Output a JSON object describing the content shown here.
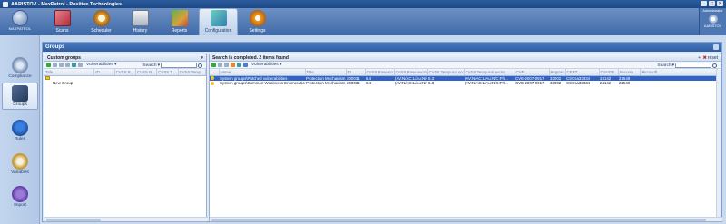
{
  "window": {
    "title": "AARISTOV - MaxPatrol - Positive Technologies",
    "controls": [
      "_",
      "□",
      "✕"
    ]
  },
  "logo": {
    "text": "MAXPATROL"
  },
  "ribbon": {
    "tabs": [
      {
        "label": "Scans",
        "icon": "scans-icon"
      },
      {
        "label": "Scheduler",
        "icon": "scheduler-icon"
      },
      {
        "label": "History",
        "icon": "history-icon"
      },
      {
        "label": "Reports",
        "icon": "reports-icon"
      },
      {
        "label": "Configuration",
        "icon": "configuration-icon",
        "active": true
      },
      {
        "label": "Settings",
        "icon": "settings-icon"
      }
    ],
    "admin": {
      "role": "Administrator",
      "user": "AARISTOV"
    }
  },
  "sidebar": {
    "items": [
      {
        "label": "Compliance"
      },
      {
        "label": "Groups",
        "active": true
      },
      {
        "label": "Rules"
      },
      {
        "label": "Variables"
      },
      {
        "label": "Import"
      }
    ]
  },
  "panel": {
    "title": "Groups",
    "left": {
      "title": "Custom groups",
      "toolbar": {
        "vulnerabilities": "Vulnerabilities",
        "search_label": "Search",
        "search_value": ""
      },
      "columns": [
        "Title",
        "ID",
        "CVSS B...",
        "CVSS B...",
        "CVSS T...",
        "CVSS Temp"
      ],
      "rows": [
        {
          "title": "New Group"
        }
      ]
    },
    "right": {
      "status": "Search is completed. 2 items found.",
      "reset": "reset",
      "toolbar": {
        "vulnerabilities": "Vulnerabilities",
        "search_label": "Search",
        "search_value": ""
      },
      "columns": [
        "Name",
        "Title",
        "ID",
        "CVSS Base score",
        "CVSS Base vector",
        "CVSS Temporal score",
        "CVSS Temporal vector",
        "CVE",
        "Bugtraq",
        "CERT",
        "OSVDB",
        "Secunia",
        "Microsoft"
      ],
      "rows": [
        {
          "name": "System groups\\Patched vulnerabilities",
          "title": "Protection Mechanism Bypassing",
          "id": "200031",
          "base_score": "6.4",
          "base_vector": "(AV:N/AC:L/Au:N/C...",
          "temp_score": "5.3",
          "temp_vector": "(AV:N/AC:L/Au:N/C:P/I...",
          "cve": "CVE-2007-0917",
          "bugtraq": "33002",
          "cert": "CSCsa33334",
          "osvdb": "24142",
          "secunia": "22549",
          "selected": true
        },
        {
          "name": "System groups\\Common Weakness Enumeration...",
          "title": "Protection Mechanism Bypassing",
          "id": "200031",
          "base_score": "6.4",
          "base_vector": "(AV:N/AC:L/Au:N/C...",
          "temp_score": "5.3",
          "temp_vector": "(AV:N/AC:L/Au:N/C:P/I...",
          "cve": "CVE-2007-0917",
          "bugtraq": "33002",
          "cert": "CSCsa33334",
          "osvdb": "24142",
          "secunia": "22549",
          "selected": false
        }
      ]
    }
  }
}
